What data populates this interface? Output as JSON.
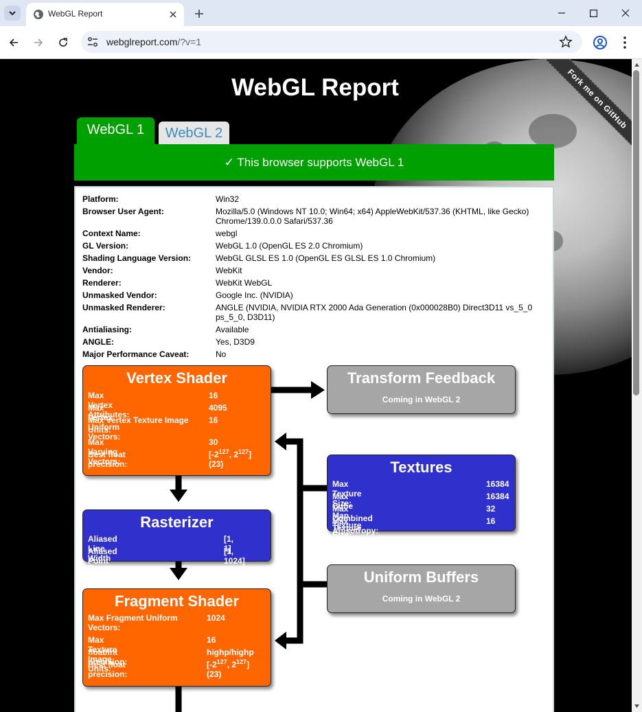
{
  "browser": {
    "tab_title": "WebGL Report",
    "url_host": "webglreport.com",
    "url_path": "/?v=1"
  },
  "page": {
    "title": "WebGL Report",
    "ribbon": "Fork me on GitHub",
    "tabs": [
      {
        "label": "WebGL 1",
        "active": true
      },
      {
        "label": "WebGL 2",
        "active": false
      }
    ],
    "support_message": "✓ This browser supports WebGL 1"
  },
  "info": [
    {
      "key": "Platform:",
      "value": "Win32"
    },
    {
      "key": "Browser User Agent:",
      "value": "Mozilla/5.0 (Windows NT 10.0; Win64; x64) AppleWebKit/537.36 (KHTML, like Gecko) Chrome/139.0.0.0 Safari/537.36"
    },
    {
      "key": "Context Name:",
      "value": "webgl"
    },
    {
      "key": "GL Version:",
      "value": "WebGL 1.0 (OpenGL ES 2.0 Chromium)"
    },
    {
      "key": "Shading Language Version:",
      "value": "WebGL GLSL ES 1.0 (OpenGL ES GLSL ES 1.0 Chromium)"
    },
    {
      "key": "Vendor:",
      "value": "WebKit"
    },
    {
      "key": "Renderer:",
      "value": "WebKit WebGL"
    },
    {
      "key": "Unmasked Vendor:",
      "value": "Google Inc. (NVIDIA)"
    },
    {
      "key": "Unmasked Renderer:",
      "value": "ANGLE (NVIDIA, NVIDIA RTX 2000 Ada Generation (0x000028B0) Direct3D11 vs_5_0 ps_5_0, D3D11)"
    },
    {
      "key": "Antialiasing:",
      "value": "Available"
    },
    {
      "key": "ANGLE:",
      "value": "Yes, D3D9"
    },
    {
      "key": "Major Performance Caveat:",
      "value": "No"
    }
  ],
  "vertex_shader": {
    "title": "Vertex Shader",
    "rows": [
      {
        "key": "Max Vertex Attributes:",
        "value": "16"
      },
      {
        "key": "Max Vertex Uniform Vectors:",
        "value": "4095"
      },
      {
        "key": "Max Vertex Texture Image Units:",
        "value": "16"
      },
      {
        "key": "Max Varying Vectors:",
        "value": "30"
      },
      {
        "key": "Best float precision:",
        "prefix": "[-2",
        "exp1": "127",
        "mid": ", 2",
        "exp2": "127",
        "suffix": "]",
        "bits": "(23)"
      }
    ]
  },
  "transform_feedback": {
    "title": "Transform Feedback",
    "note": "Coming in WebGL 2"
  },
  "textures": {
    "title": "Textures",
    "rows": [
      {
        "key": "Max Texture Size:",
        "value": "16384"
      },
      {
        "key": "Max Cube Map Texture Size:",
        "value": "16384"
      },
      {
        "key": "Max Combined Texture Image Units:",
        "value": "32"
      },
      {
        "key": "Max Anisotropy:",
        "value": "16"
      }
    ]
  },
  "rasterizer": {
    "title": "Rasterizer",
    "rows": [
      {
        "key": "Aliased Line Width Range:",
        "value": "[1, 1]"
      },
      {
        "key": "Aliased Point Size Range:",
        "value": "[1, 1024]"
      }
    ]
  },
  "uniform_buffers": {
    "title": "Uniform Buffers",
    "note": "Coming in WebGL 2"
  },
  "fragment_shader": {
    "title": "Fragment Shader",
    "rows": [
      {
        "key": "Max Fragment Uniform Vectors:",
        "value": "1024"
      },
      {
        "key": "Max Texture Image Units:",
        "value": "16"
      },
      {
        "key": "float/int precision:",
        "value": "highp/highp"
      },
      {
        "key": "Best float precision:",
        "prefix": "[-2",
        "exp1": "127",
        "mid": ", 2",
        "exp2": "127",
        "suffix": "]",
        "bits": "(23)"
      }
    ]
  },
  "colors": {
    "green": "#00a000",
    "orange": "#ff6600",
    "blue": "#3030cc",
    "gray": "#a6a6a6"
  }
}
